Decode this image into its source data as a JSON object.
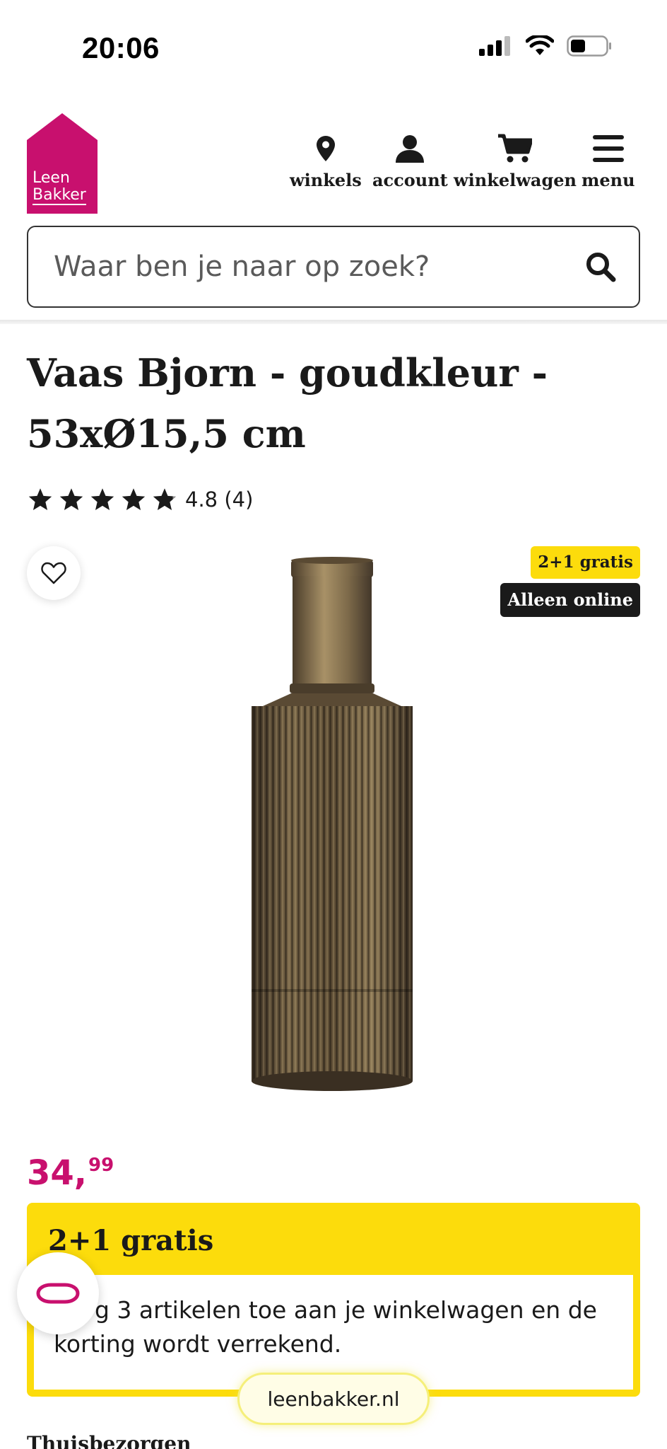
{
  "status_bar": {
    "time": "20:06"
  },
  "brand": {
    "logo_line1": "Leen",
    "logo_line2": "Bakker",
    "color": "#c8106e"
  },
  "nav": [
    {
      "key": "winkels",
      "label": "winkels",
      "icon": "location-pin-icon"
    },
    {
      "key": "account",
      "label": "account",
      "icon": "user-icon"
    },
    {
      "key": "winkelwagen",
      "label": "winkelwagen",
      "icon": "cart-icon"
    },
    {
      "key": "menu",
      "label": "menu",
      "icon": "hamburger-icon"
    }
  ],
  "search": {
    "placeholder": "Waar ben je naar op zoek?",
    "value": ""
  },
  "product": {
    "title": "Vaas Bjorn - goudkleur - 53xØ15,5 cm",
    "rating_text": "4.8 (4)",
    "rating_value": 4.8,
    "rating_max": 5,
    "badge_promo": "2+1 gratis",
    "badge_online": "Alleen online",
    "price_main": "34,",
    "price_cents": "99"
  },
  "promo": {
    "title": "2+1 gratis",
    "text": "g 3 artikelen toe aan je winkelwagen en de korting wordt verrekend."
  },
  "browser": {
    "url": "leenbakker.nl"
  },
  "delivery": {
    "heading": "Thuisbezorgen"
  },
  "colors": {
    "accent": "#c8106e",
    "promo_yellow": "#fcdc0c",
    "dark": "#1a1a1a"
  }
}
